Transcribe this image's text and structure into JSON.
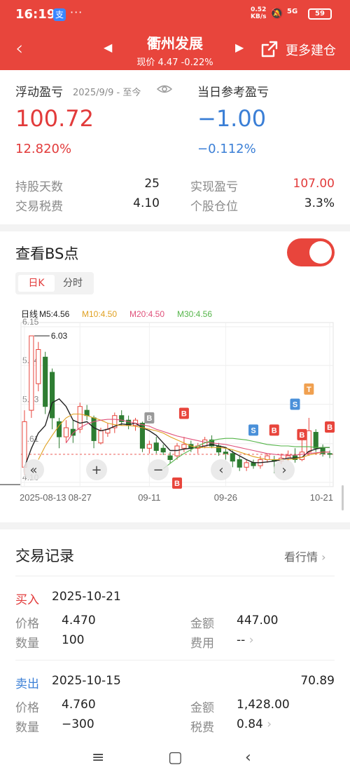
{
  "status_bar": {
    "time": "16:19",
    "app_badge": "支",
    "dots": "···",
    "net_speed_top": "0.52",
    "net_speed_bottom": "KB/s",
    "signal": "5G",
    "battery": "59"
  },
  "header": {
    "back_icon": "chevron-left-icon",
    "stock_name": "衢州发展",
    "price_line": "现价 4.47 -0.22%",
    "more_label": "更多建仓"
  },
  "summary": {
    "float_label": "浮动盈亏",
    "float_date": "2025/9/9 - 至今",
    "float_value": "100.72",
    "float_pct": "12.820%",
    "daily_label": "当日参考盈亏",
    "daily_value": "−1.00",
    "daily_pct": "−0.112%",
    "rows": [
      {
        "l1": "持股天数",
        "v1": "25",
        "l2": "实现盈亏",
        "v2": "107.00"
      },
      {
        "l1": "交易税费",
        "v1": "4.10",
        "l2": "个股仓位",
        "v2": "3.3%"
      }
    ]
  },
  "bs": {
    "title": "查看BS点",
    "tab_day": "日K",
    "tab_min": "分时"
  },
  "chart_data": {
    "type": "candlestick",
    "legend": [
      {
        "label": "日线",
        "color": "#222222"
      },
      {
        "label": "M5:4.56",
        "color": "#222222"
      },
      {
        "label": "M10:4.50",
        "color": "#e0a020"
      },
      {
        "label": "M20:4.50",
        "color": "#e0507a"
      },
      {
        "label": "M30:4.56",
        "color": "#55b54a"
      }
    ],
    "y_ticks": [
      "6.15",
      "5.64",
      "5.13",
      "4.61",
      "4.10"
    ],
    "ylim": [
      4.1,
      6.15
    ],
    "x_labels": [
      {
        "label": "2025-08-13",
        "index": 0
      },
      {
        "label": "08-27",
        "index": 8
      },
      {
        "label": "09-11",
        "index": 18
      },
      {
        "label": "09-26",
        "index": 29
      },
      {
        "label": "10-21",
        "index": 44
      }
    ],
    "high_label": "6.03",
    "low_label": "4.22",
    "candles": [
      {
        "o": 4.3,
        "c": 4.9,
        "h": 5.05,
        "l": 4.2
      },
      {
        "o": 5.05,
        "c": 6.03,
        "h": 6.03,
        "l": 4.95
      },
      {
        "o": 5.4,
        "c": 5.85,
        "h": 5.95,
        "l": 5.3
      },
      {
        "o": 5.75,
        "c": 5.1,
        "h": 5.82,
        "l": 5.0
      },
      {
        "o": 5.55,
        "c": 4.95,
        "h": 5.6,
        "l": 4.8
      },
      {
        "o": 4.9,
        "c": 4.7,
        "h": 4.95,
        "l": 4.55
      },
      {
        "o": 4.7,
        "c": 4.82,
        "h": 4.92,
        "l": 4.62
      },
      {
        "o": 4.8,
        "c": 4.72,
        "h": 4.92,
        "l": 4.62
      },
      {
        "o": 4.8,
        "c": 5.1,
        "h": 5.15,
        "l": 4.75
      },
      {
        "o": 5.05,
        "c": 4.98,
        "h": 5.12,
        "l": 4.92
      },
      {
        "o": 4.95,
        "c": 4.65,
        "h": 4.98,
        "l": 4.55
      },
      {
        "o": 4.62,
        "c": 4.78,
        "h": 4.82,
        "l": 4.6
      },
      {
        "o": 4.75,
        "c": 4.8,
        "h": 4.88,
        "l": 4.7
      },
      {
        "o": 4.82,
        "c": 4.98,
        "h": 5.02,
        "l": 4.75
      },
      {
        "o": 4.98,
        "c": 4.9,
        "h": 5.05,
        "l": 4.85
      },
      {
        "o": 4.92,
        "c": 4.85,
        "h": 4.98,
        "l": 4.8
      },
      {
        "o": 4.85,
        "c": 4.92,
        "h": 4.95,
        "l": 4.78
      },
      {
        "o": 4.88,
        "c": 4.55,
        "h": 4.9,
        "l": 4.5
      },
      {
        "o": 4.55,
        "c": 4.6,
        "h": 4.65,
        "l": 4.48
      },
      {
        "o": 4.62,
        "c": 4.52,
        "h": 4.7,
        "l": 4.48
      },
      {
        "o": 4.55,
        "c": 4.5,
        "h": 4.6,
        "l": 4.46
      },
      {
        "o": 4.45,
        "c": 4.4,
        "h": 4.5,
        "l": 4.35
      },
      {
        "o": 4.45,
        "c": 4.58,
        "h": 4.62,
        "l": 4.4
      },
      {
        "o": 4.55,
        "c": 4.6,
        "h": 4.7,
        "l": 4.5
      },
      {
        "o": 4.6,
        "c": 4.55,
        "h": 4.65,
        "l": 4.5
      },
      {
        "o": 4.55,
        "c": 4.58,
        "h": 4.62,
        "l": 4.48
      },
      {
        "o": 4.58,
        "c": 4.66,
        "h": 4.7,
        "l": 4.55
      },
      {
        "o": 4.66,
        "c": 4.58,
        "h": 4.72,
        "l": 4.55
      },
      {
        "o": 4.58,
        "c": 4.5,
        "h": 4.62,
        "l": 4.45
      },
      {
        "o": 4.5,
        "c": 4.48,
        "h": 4.55,
        "l": 4.4
      },
      {
        "o": 4.48,
        "c": 4.38,
        "h": 4.52,
        "l": 4.3
      },
      {
        "o": 4.4,
        "c": 4.3,
        "h": 4.45,
        "l": 4.25
      },
      {
        "o": 4.3,
        "c": 4.36,
        "h": 4.4,
        "l": 4.25
      },
      {
        "o": 4.36,
        "c": 4.32,
        "h": 4.4,
        "l": 4.28
      },
      {
        "o": 4.32,
        "c": 4.4,
        "h": 4.45,
        "l": 4.28
      },
      {
        "o": 4.4,
        "c": 4.45,
        "h": 4.48,
        "l": 4.36
      },
      {
        "o": 4.4,
        "c": 4.38,
        "h": 4.45,
        "l": 4.22
      },
      {
        "o": 4.38,
        "c": 4.42,
        "h": 4.48,
        "l": 4.34
      },
      {
        "o": 4.42,
        "c": 4.45,
        "h": 4.52,
        "l": 4.38
      },
      {
        "o": 4.45,
        "c": 4.4,
        "h": 4.55,
        "l": 4.36
      },
      {
        "o": 4.4,
        "c": 4.5,
        "h": 4.75,
        "l": 4.38
      },
      {
        "o": 4.5,
        "c": 4.78,
        "h": 4.95,
        "l": 4.45
      },
      {
        "o": 4.76,
        "c": 4.55,
        "h": 4.8,
        "l": 4.5
      },
      {
        "o": 4.55,
        "c": 4.48,
        "h": 4.6,
        "l": 4.44
      },
      {
        "o": 4.48,
        "c": 4.47,
        "h": 4.52,
        "l": 4.42
      }
    ],
    "ma_lines": [
      {
        "name": "M5",
        "color": "#222222",
        "values": [
          4.3,
          4.55,
          4.75,
          4.85,
          5.15,
          5.2,
          5.1,
          4.92,
          4.88,
          4.9,
          4.82,
          4.78,
          4.8,
          4.84,
          4.87,
          4.86,
          4.88,
          4.82,
          4.78,
          4.72,
          4.62,
          4.52,
          4.52,
          4.54,
          4.55,
          4.56,
          4.58,
          4.6,
          4.58,
          4.56,
          4.5,
          4.45,
          4.4,
          4.36,
          4.36,
          4.37,
          4.38,
          4.4,
          4.42,
          4.42,
          4.43,
          4.51,
          4.54,
          4.56,
          4.56
        ]
      },
      {
        "name": "M10",
        "color": "#e0a020",
        "values": [
          null,
          null,
          4.4,
          4.58,
          4.72,
          4.85,
          4.95,
          5.0,
          5.0,
          4.98,
          4.95,
          4.92,
          4.88,
          4.86,
          4.85,
          4.85,
          4.84,
          4.82,
          4.8,
          4.78,
          4.75,
          4.7,
          4.66,
          4.62,
          4.58,
          4.56,
          4.56,
          4.56,
          4.56,
          4.55,
          4.53,
          4.5,
          4.47,
          4.44,
          4.42,
          4.4,
          4.4,
          4.4,
          4.4,
          4.41,
          4.43,
          4.46,
          4.48,
          4.5,
          4.5
        ]
      },
      {
        "name": "M20",
        "color": "#e0507a",
        "values": [
          null,
          null,
          null,
          null,
          null,
          null,
          4.62,
          4.75,
          4.82,
          4.87,
          4.9,
          4.92,
          4.93,
          4.93,
          4.92,
          4.9,
          4.88,
          4.86,
          4.84,
          4.8,
          4.77,
          4.74,
          4.71,
          4.69,
          4.67,
          4.65,
          4.63,
          4.62,
          4.61,
          4.6,
          4.58,
          4.56,
          4.54,
          4.52,
          4.5,
          4.48,
          4.47,
          4.46,
          4.46,
          4.46,
          4.47,
          4.48,
          4.49,
          4.5,
          4.5
        ]
      },
      {
        "name": "M30",
        "color": "#55b54a",
        "values": [
          null,
          null,
          null,
          null,
          null,
          null,
          null,
          null,
          null,
          null,
          null,
          null,
          null,
          null,
          null,
          null,
          null,
          null,
          null,
          null,
          4.28,
          4.35,
          4.42,
          4.48,
          4.53,
          4.58,
          4.62,
          4.65,
          4.67,
          4.68,
          4.68,
          4.67,
          4.66,
          4.64,
          4.62,
          4.6,
          4.59,
          4.58,
          4.58,
          4.57,
          4.57,
          4.57,
          4.56,
          4.56,
          4.56
        ]
      }
    ],
    "markers": [
      {
        "index": 18,
        "label": "B",
        "color": "#999999",
        "pos": "above",
        "price": 4.82
      },
      {
        "index": 23,
        "label": "B",
        "color": "#e8453c",
        "pos": "above",
        "price": 4.88
      },
      {
        "index": 22,
        "label": "B",
        "color": "#e8453c",
        "pos": "below",
        "price": 4.22
      },
      {
        "index": 33,
        "label": "S",
        "color": "#4a90d9",
        "pos": "above",
        "price": 4.66
      },
      {
        "index": 36,
        "label": "B",
        "color": "#e8453c",
        "pos": "above",
        "price": 4.66
      },
      {
        "index": 40,
        "label": "B",
        "color": "#e8453c",
        "pos": "above",
        "price": 4.6
      },
      {
        "index": 39,
        "label": "S",
        "color": "#4a90d9",
        "pos": "above",
        "price": 5.0
      },
      {
        "index": 41,
        "label": "T",
        "color": "#f0a050",
        "pos": "above",
        "price": 5.2
      },
      {
        "index": 44,
        "label": "B",
        "color": "#e8453c",
        "pos": "above",
        "price": 4.7
      }
    ],
    "controls": [
      "«",
      "+",
      "−",
      "‹",
      "›"
    ]
  },
  "records": {
    "title": "交易记录",
    "more_label": "看行情",
    "items": [
      {
        "type": "买入",
        "date": "2025-10-21",
        "price_label": "价格",
        "price": "4.470",
        "amount_label": "金额",
        "amount": "447.00",
        "qty_label": "数量",
        "qty": "100",
        "fee_label": "费用",
        "fee": "--",
        "profit": ""
      },
      {
        "type": "卖出",
        "date": "2025-10-15",
        "price_label": "价格",
        "price": "4.760",
        "amount_label": "金额",
        "amount": "1,428.00",
        "qty_label": "数量",
        "qty": "−300",
        "fee_label": "税费",
        "fee": "0.84",
        "profit": "70.89"
      }
    ]
  },
  "navbar": {
    "menu_icon": "≡",
    "home_icon": "▢",
    "back_icon": "‹"
  }
}
